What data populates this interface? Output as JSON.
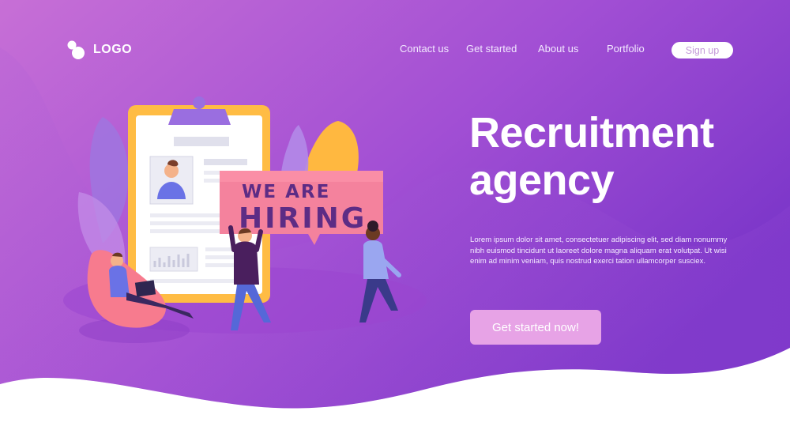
{
  "brand": {
    "logo_text": "LOGO"
  },
  "nav": {
    "links": [
      "Contact us",
      "Get started",
      "About us",
      "Portfolio"
    ],
    "signup_label": "Sign up"
  },
  "hero": {
    "title_line1": "Recruitment",
    "title_line2": "agency",
    "body": "Lorem ipsum dolor sit amet, consectetuer adipiscing elit, sed diam nonummy nibh euismod tincidunt ut laoreet dolore magna aliquam erat volutpat. Ut wisi enim ad minim veniam, quis nostrud exerci tation ullamcorper susciex.",
    "cta_label": "Get started now!"
  },
  "illustration": {
    "sign_line1": "WE ARE",
    "sign_line2": "HIRING"
  },
  "colors": {
    "gradient_start": "#c76fd6",
    "gradient_end": "#7a35c9",
    "cta": "#e7a3e6",
    "sign": "#f4829d"
  }
}
